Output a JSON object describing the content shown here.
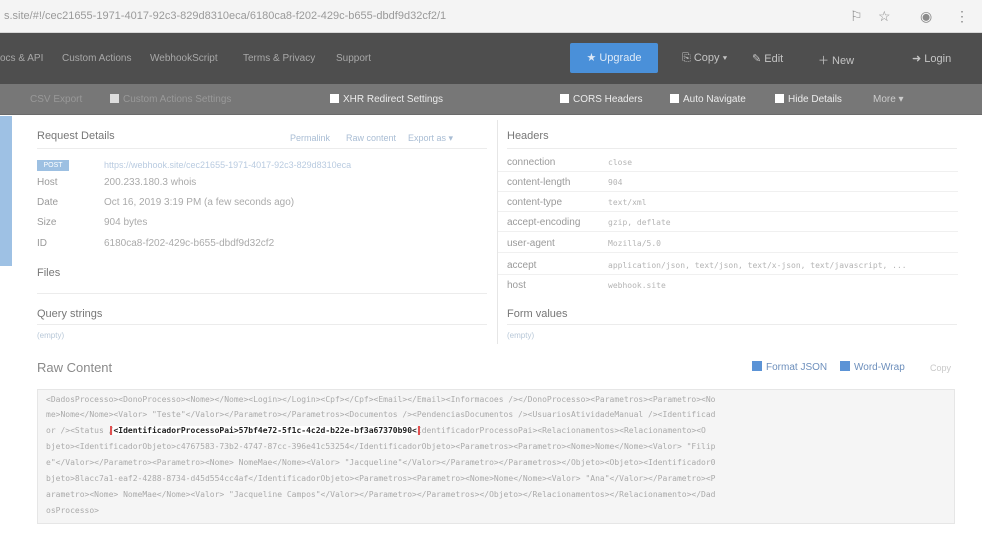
{
  "browser": {
    "url": "s.site/#!/cec21655-1971-4017-92c3-829d8310eca/6180ca8-f202-429c-b655-dbdf9d32cf2/1",
    "icons": [
      "translate-icon",
      "star-icon",
      "account-icon",
      "menu-icon"
    ]
  },
  "nav": {
    "links": [
      "ocs & API",
      "Custom Actions",
      "WebhookScript",
      "Terms & Privacy",
      "Support"
    ],
    "upgrade": "★ Upgrade",
    "copy": "⎘ Copy ▾",
    "edit": "✎ Edit",
    "new": "＋ New",
    "login": "➜ Login"
  },
  "toolbar": {
    "items": [
      {
        "label": "CSV Export",
        "on": false
      },
      {
        "label": "Custom Actions Settings",
        "on": false
      },
      {
        "label": "XHR Redirect Settings",
        "on": true
      },
      {
        "label": "CORS Headers",
        "on": true
      },
      {
        "label": "Auto Navigate",
        "on": true
      },
      {
        "label": "Hide Details",
        "on": true
      }
    ],
    "more": "More ▾"
  },
  "request": {
    "title": "Request Details",
    "permalink": "Permalink",
    "raw_content": "Raw content",
    "export_as": "Export as ▾",
    "method": "POST",
    "url": "https://webhook.site/cec21655-1971-4017-92c3-829d8310eca",
    "host_label": "Host",
    "host": "200.233.180.3 whois",
    "date_label": "Date",
    "date": "Oct 16, 2019 3:19 PM (a few seconds ago)",
    "size_label": "Size",
    "size": "904 bytes",
    "id_label": "ID",
    "id": "6180ca8-f202-429c-b655-dbdf9d32cf2"
  },
  "files": {
    "title": "Files"
  },
  "query": {
    "title": "Query strings",
    "empty": "(empty)"
  },
  "headers": {
    "title": "Headers",
    "rows": [
      {
        "key": "connection",
        "value": "close"
      },
      {
        "key": "content-length",
        "value": "904"
      },
      {
        "key": "content-type",
        "value": "text/xml"
      },
      {
        "key": "accept-encoding",
        "value": "gzip, deflate"
      },
      {
        "key": "user-agent",
        "value": "Mozilla/5.0"
      },
      {
        "key": "accept",
        "value": "application/json, text/json, text/x-json, text/javascript, ..."
      },
      {
        "key": "host",
        "value": "webhook.site"
      }
    ]
  },
  "form": {
    "title": "Form values",
    "empty": "(empty)"
  },
  "raw": {
    "title": "Raw Content",
    "format_json": "Format JSON",
    "word_wrap": "Word-Wrap",
    "copy": "Copy",
    "lines": [
      {
        "text": "<DadosProcesso><DonoProcesso><Nome></Nome><Login></Login><Cpf></Cpf><Email></Email><Informacoes /></DonoProcesso><Parametros><Parametro><No"
      },
      {
        "text": "me>Nome</Nome><Valor> \"Teste\"</Valor></Parametro></Parametros><Documentos /><PendenciasDocumentos /><UsuariosAtividadeManual /><Identificad"
      },
      {
        "before": "or /><Status /",
        "highlight": "<IdentificadorProcessoPai>57bf4e72-5f1c-4c2d-b22e-bf3a67370b90<",
        "after": "IdentificadorProcessoPai><Relacionamentos><Relacionamento><O"
      },
      {
        "text": "bjeto><IdentificadorObjeto>c4767583-73b2-4747-87cc-396e41c53254</IdentificadorObjeto><Parametros><Parametro><Nome>Nome</Nome><Valor> \"Filip"
      },
      {
        "text": "e\"</Valor></Parametro><Parametro><Nome> NomeMae</Nome><Valor> \"Jacqueline\"</Valor></Parametro></Parametros></Objeto><Objeto><Identificador0"
      },
      {
        "text": "bjeto>8lacc7a1-eaf2-4288-8734-d45d554cc4af</IdentificadorObjeto><Parametros><Parametro><Nome>Nome</Nome><Valor> \"Ana\"</Valor></Parametro><P"
      },
      {
        "text": "arametro><Nome> NomeMae</Nome><Valor> \"Jacqueline Campos\"</Valor></Parametro></Parametros></Objeto></Relacionamentos></Relacionamento></Dad"
      },
      {
        "text": "osProcesso>"
      }
    ]
  }
}
